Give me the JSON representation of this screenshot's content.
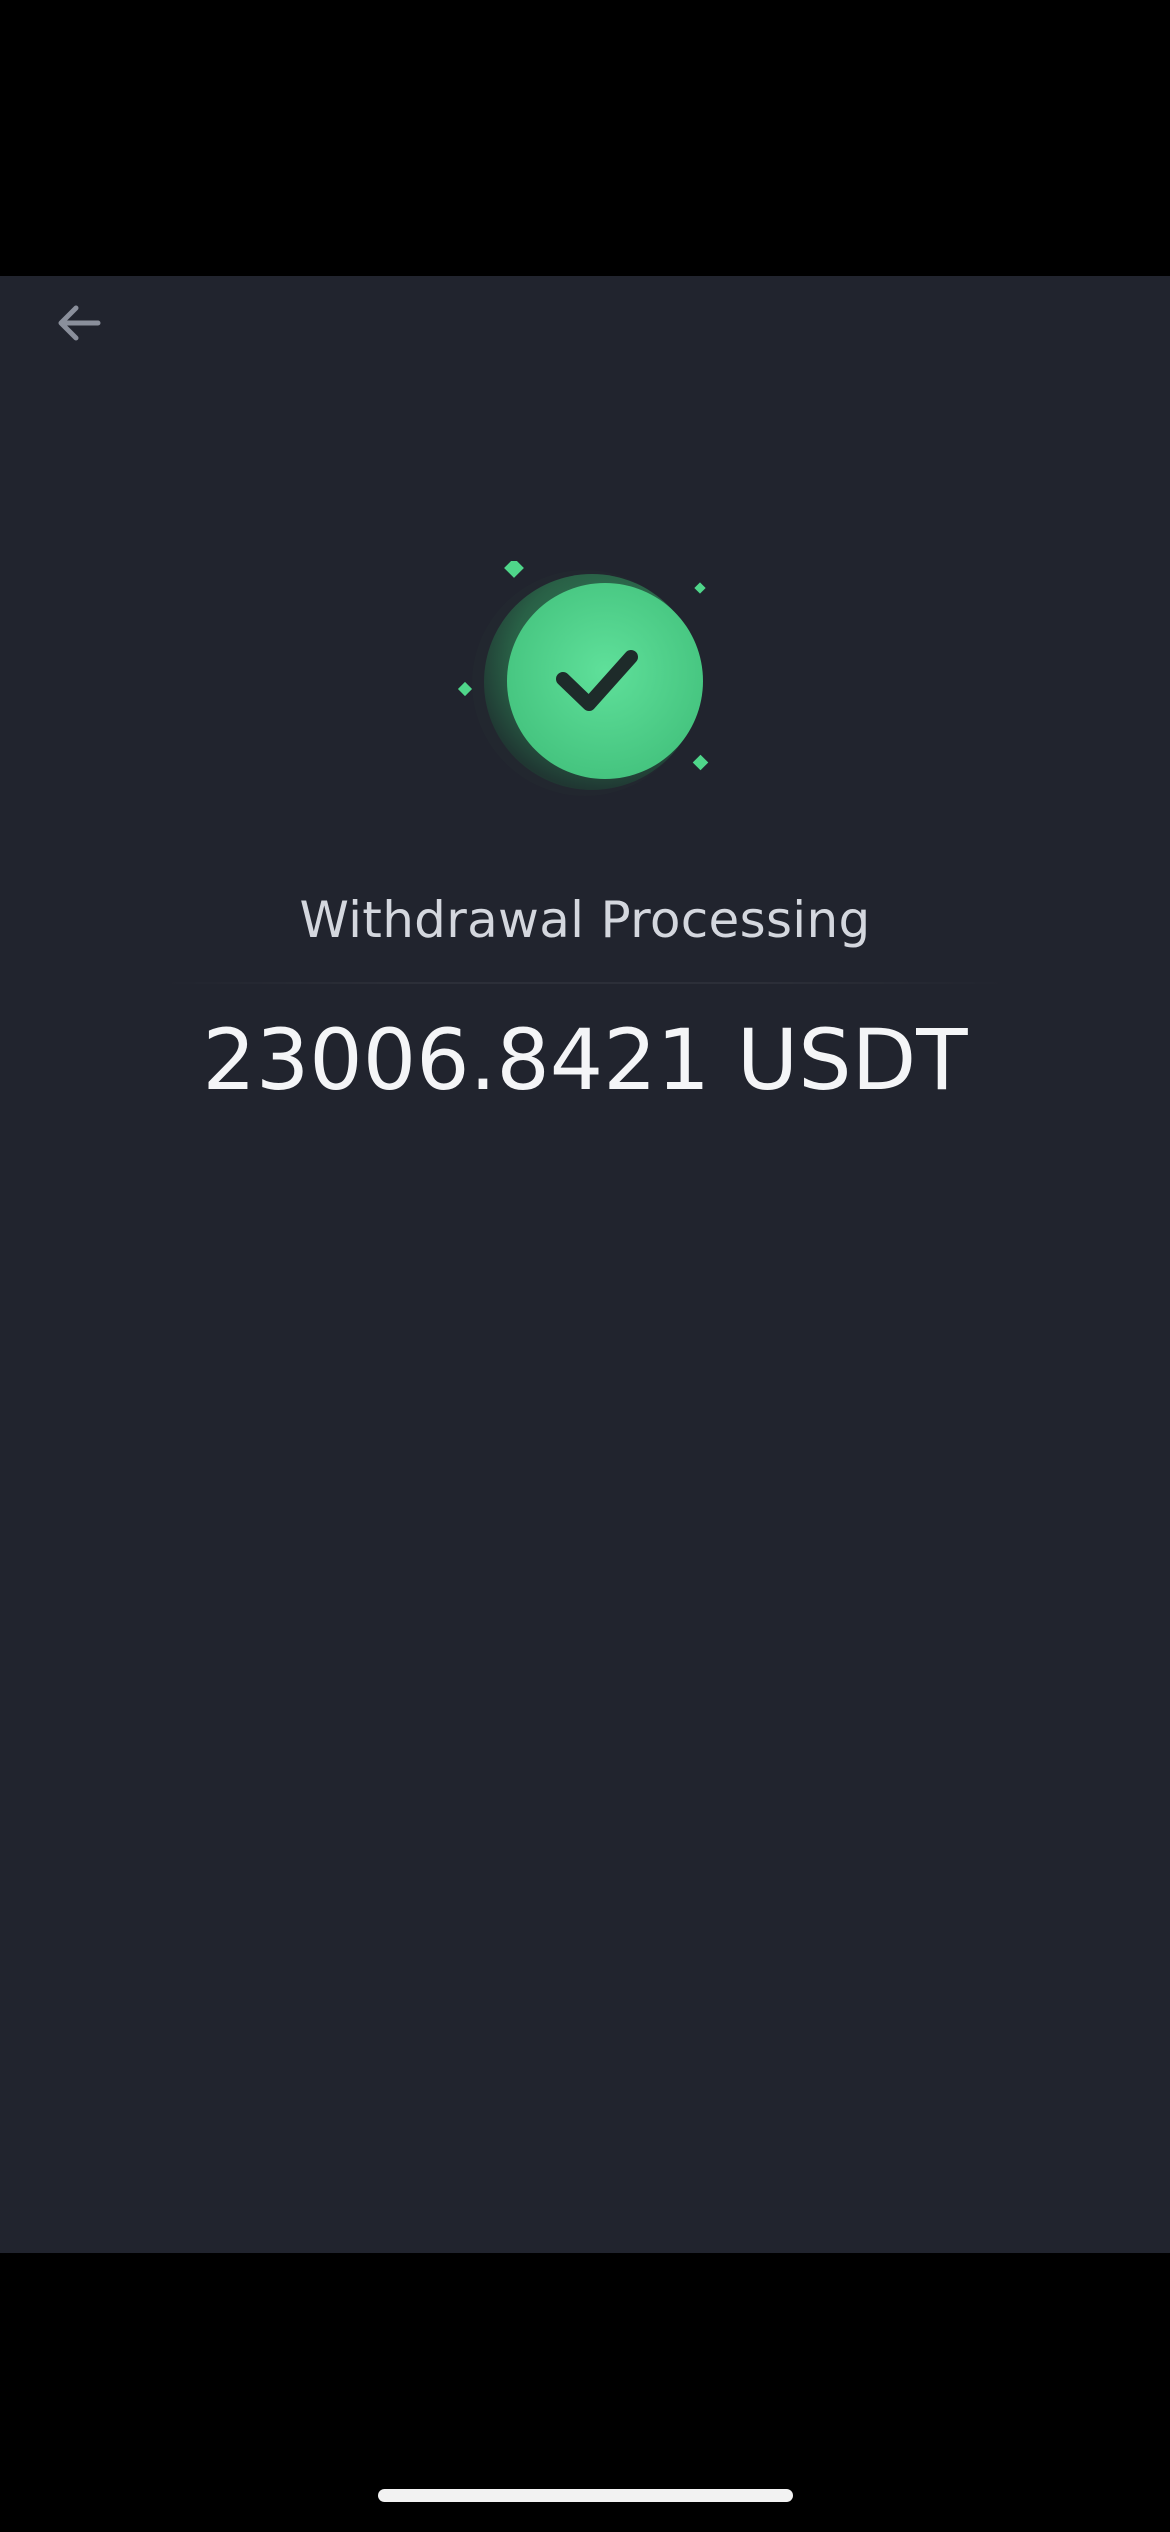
{
  "header": {
    "back_icon": "arrow-left-icon"
  },
  "status": {
    "icon": "check-circle-icon",
    "title": "Withdrawal Processing",
    "amount": "23006.8421 USDT"
  },
  "colors": {
    "background": "#21242e",
    "success_green": "#4fd68a",
    "title_text": "#d4d7de",
    "amount_text": "#f4f5f7"
  }
}
